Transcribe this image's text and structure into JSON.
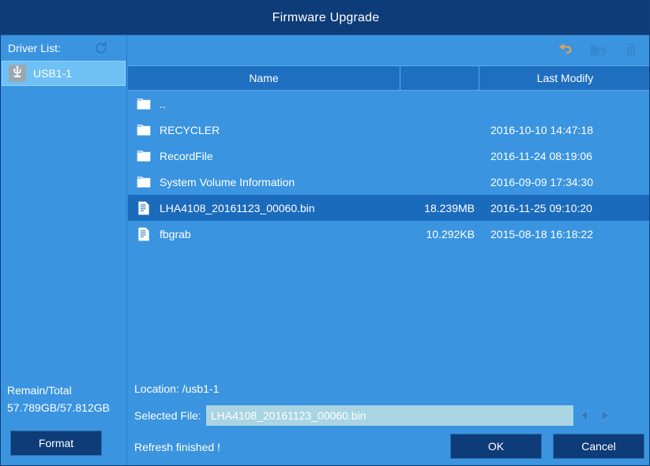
{
  "window": {
    "title": "Firmware Upgrade"
  },
  "sidebar": {
    "driver_list_label": "Driver List:",
    "refresh_icon": "refresh-icon",
    "drivers": [
      {
        "name": "USB1-1",
        "icon": "usb-icon",
        "selected": true
      }
    ],
    "remain_total_label": "Remain/Total",
    "remain_total_value": "57.789GB/57.812GB",
    "format_label": "Format"
  },
  "toolbar": {
    "icons": [
      {
        "name": "back-arrow-icon",
        "enabled": true
      },
      {
        "name": "new-folder-icon",
        "enabled": false
      },
      {
        "name": "delete-icon",
        "enabled": false
      }
    ]
  },
  "file_table": {
    "columns": [
      "Name",
      "",
      "Last Modify"
    ],
    "rows": [
      {
        "icon": "folder-icon",
        "name": "..",
        "size": "",
        "modified": "",
        "selected": false
      },
      {
        "icon": "folder-icon",
        "name": "RECYCLER",
        "size": "",
        "modified": "2016-10-10 14:47:18",
        "selected": false
      },
      {
        "icon": "folder-icon",
        "name": "RecordFile",
        "size": "",
        "modified": "2016-11-24 08:19:06",
        "selected": false
      },
      {
        "icon": "folder-icon",
        "name": "System Volume Information",
        "size": "",
        "modified": "2016-09-09 17:34:30",
        "selected": false
      },
      {
        "icon": "file-icon",
        "name": "LHA4108_20161123_00060.bin",
        "size": "18.239MB",
        "modified": "2016-11-25 09:10:20",
        "selected": true
      },
      {
        "icon": "file-icon",
        "name": "fbgrab",
        "size": "10.292KB",
        "modified": "2015-08-18 16:18:22",
        "selected": false
      }
    ]
  },
  "footer": {
    "location_text": "Location: /usb1-1",
    "selected_file_label": "Selected File:",
    "selected_file_value": "LHA4108_20161123_00060.bin",
    "prev_icon": "arrow-left-icon",
    "next_icon": "arrow-right-icon",
    "status_text": "Refresh finished !",
    "ok_label": "OK",
    "cancel_label": "Cancel"
  },
  "colors": {
    "titlebar": "#0d3c78",
    "panel": "#3a94e0",
    "header_row": "#1f6fc0",
    "selected_row": "#1b6bbd",
    "driver_selected": "#6fc0f5",
    "input_bg": "#a9d4e2",
    "button": "#0d3c78",
    "back_arrow": "#d9a05b"
  }
}
